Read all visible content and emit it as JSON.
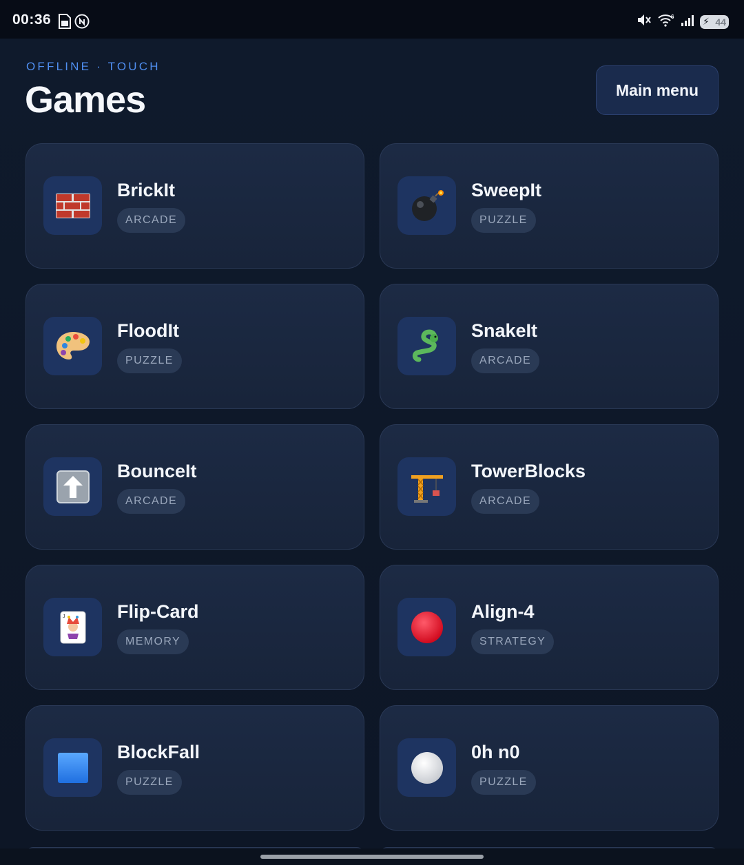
{
  "status_bar": {
    "time": "00:36",
    "battery_level": "44",
    "left_icons": [
      "sim-card-icon",
      "nfc-icon"
    ],
    "right_icons": [
      "mute-icon",
      "wifi-6-icon",
      "signal-icon",
      "battery-charging-icon"
    ]
  },
  "header": {
    "eyebrow": "OFFLINE · TOUCH",
    "title": "Games",
    "main_menu_label": "Main menu"
  },
  "games": [
    {
      "name": "BrickIt",
      "tag": "ARCADE",
      "icon": "brick-wall-icon"
    },
    {
      "name": "SweepIt",
      "tag": "PUZZLE",
      "icon": "bomb-icon"
    },
    {
      "name": "FloodIt",
      "tag": "PUZZLE",
      "icon": "palette-icon"
    },
    {
      "name": "SnakeIt",
      "tag": "ARCADE",
      "icon": "snake-icon"
    },
    {
      "name": "BounceIt",
      "tag": "ARCADE",
      "icon": "up-arrow-icon"
    },
    {
      "name": "TowerBlocks",
      "tag": "ARCADE",
      "icon": "crane-icon"
    },
    {
      "name": "Flip-Card",
      "tag": "MEMORY",
      "icon": "joker-card-icon"
    },
    {
      "name": "Align-4",
      "tag": "STRATEGY",
      "icon": "red-circle-icon"
    },
    {
      "name": "BlockFall",
      "tag": "PUZZLE",
      "icon": "blue-square-icon"
    },
    {
      "name": "0h n0",
      "tag": "PUZZLE",
      "icon": "white-circle-icon"
    }
  ]
}
